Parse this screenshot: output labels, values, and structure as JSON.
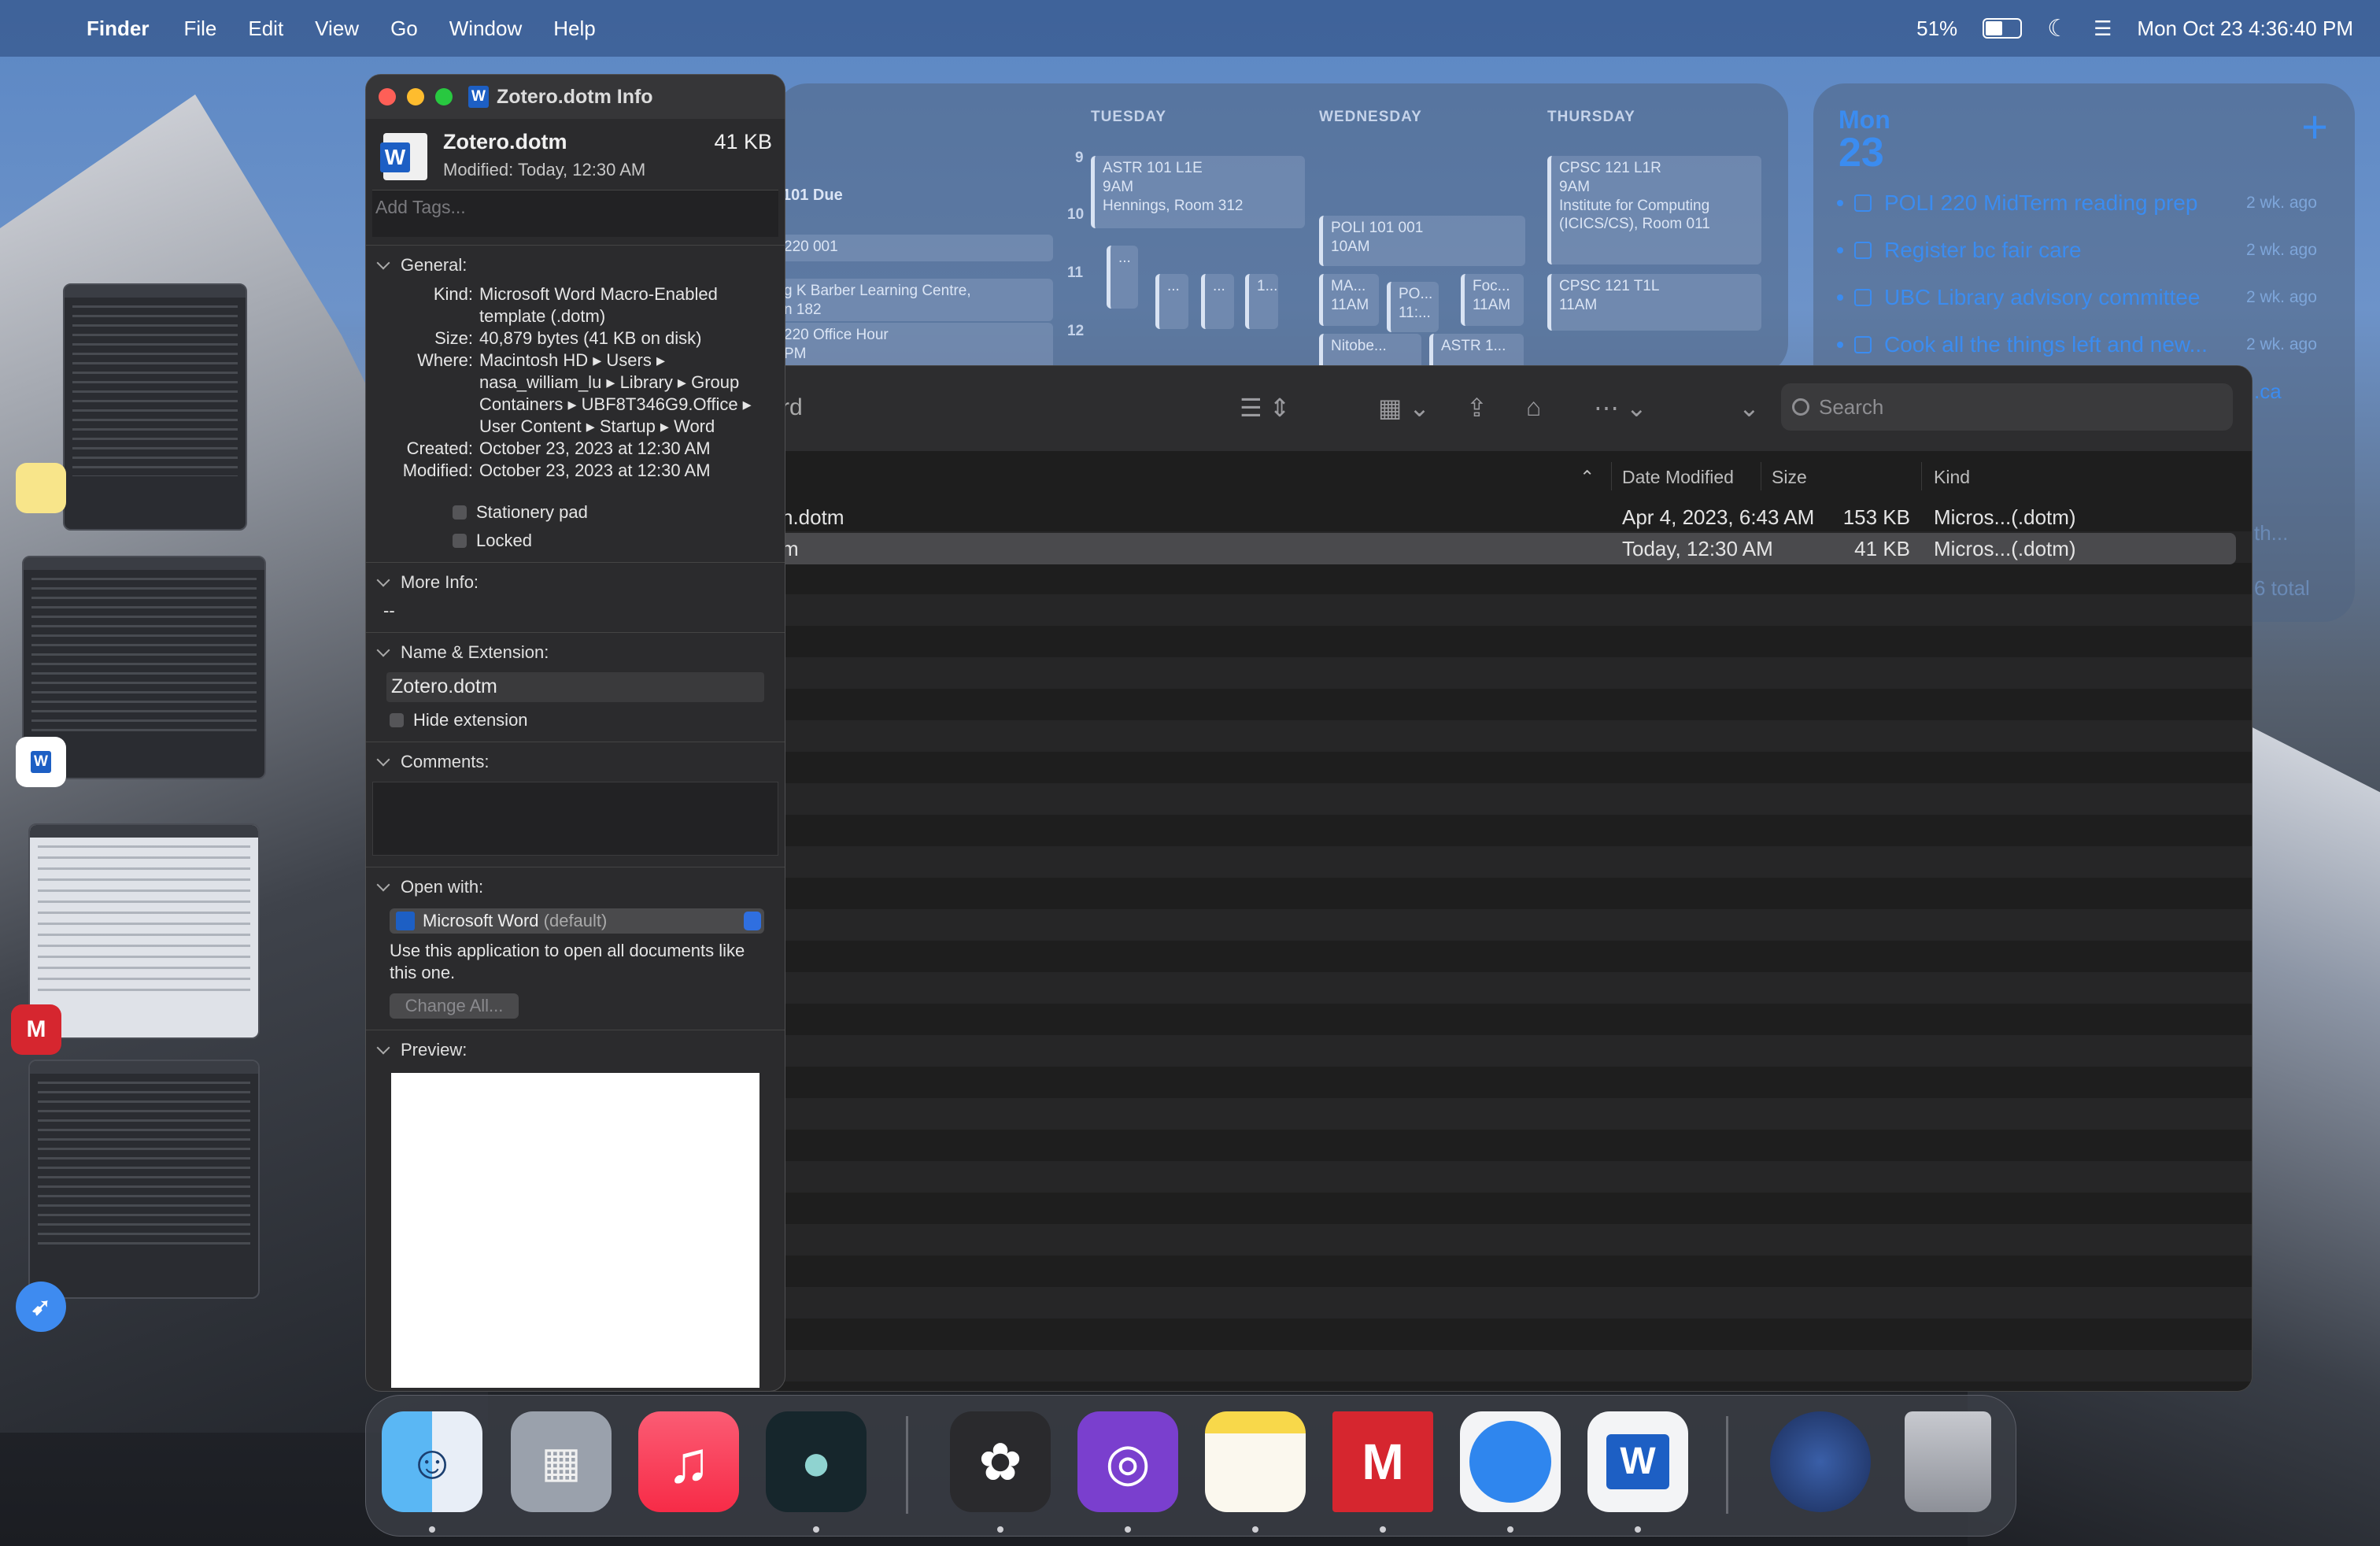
{
  "menubar": {
    "app_name": "Finder",
    "menus": [
      "File",
      "Edit",
      "View",
      "Go",
      "Window",
      "Help"
    ],
    "battery_percent": "51%",
    "battery_level": 0.51,
    "datetime": "Mon Oct 23  4:36:40 PM"
  },
  "calendar_widget": {
    "days": [
      "TUESDAY",
      "WEDNESDAY",
      "THURSDAY"
    ],
    "hours": [
      "9",
      "10",
      "11",
      "12"
    ],
    "left_events": [
      "101 Due",
      "220 001",
      "g K Barber Learning Centre,",
      "n 182",
      "220 Office Hour",
      "PM"
    ],
    "events": {
      "astr_title": "ASTR 101 L1E",
      "astr_time": "9AM",
      "astr_loc": "Hennings, Room 312",
      "poli_title": "POLI 101 001",
      "poli_time": "10AM",
      "ma_title": "MA...",
      "ma_time": "11AM",
      "po_title": "PO...",
      "po_time": "11:...",
      "foc_title": "Foc...",
      "foc_time": "11AM",
      "nitobe_title": "Nitobe...",
      "astr2_title": "ASTR 1...",
      "cpsc_title": "CPSC 121 L1R",
      "cpsc_time": "9AM",
      "cpsc_loc1": "Institute for Computing",
      "cpsc_loc2": "(ICICS/CS), Room 011",
      "cpsct_title": "CPSC 121 T1L",
      "cpsct_time": "11AM",
      "dots": "...",
      "one_dots": "1..."
    }
  },
  "reminders_widget": {
    "day_name": "Mon",
    "day_num": "23",
    "items": [
      {
        "title": "POLI 220 MidTerm reading prep",
        "ago": "2 wk. ago"
      },
      {
        "title": "Register bc fair care",
        "ago": "2 wk. ago"
      },
      {
        "title": "UBC Library advisory committee",
        "ago": "2 wk. ago"
      },
      {
        "title": "Cook all the things left and new...",
        "ago": "2 wk. ago"
      }
    ],
    "partial": [
      ".ca",
      "th...",
      "6 total"
    ]
  },
  "finder": {
    "title_fragment": "rd",
    "search_placeholder": "Search",
    "columns": {
      "date": "Date Modified",
      "size": "Size",
      "kind": "Kind"
    },
    "rows": [
      {
        "name": "n.dotm",
        "date": "Apr 4, 2023, 6:43 AM",
        "size": "153 KB",
        "kind": "Micros...(.dotm)"
      },
      {
        "name": "m",
        "date": "Today, 12:30 AM",
        "size": "41 KB",
        "kind": "Micros...(.dotm)"
      }
    ]
  },
  "info": {
    "window_title": "Zotero.dotm Info",
    "file_name": "Zotero.dotm",
    "file_size": "41 KB",
    "modified_short": "Modified:  Today, 12:30 AM",
    "tags_placeholder": "Add Tags...",
    "general_label": "General:",
    "kind_label": "Kind:",
    "kind_value": "Microsoft Word Macro-Enabled template (.dotm)",
    "size_label": "Size:",
    "size_value": "40,879 bytes (41 KB on disk)",
    "where_label": "Where:",
    "where_value": "Macintosh HD ▸ Users ▸ nasa_william_lu ▸ Library ▸ Group Containers ▸ UBF8T346G9.Office ▸ User Content ▸ Startup ▸ Word",
    "created_label": "Created:",
    "created_value": "October 23, 2023 at 12:30 AM",
    "modified_label": "Modified:",
    "modified_value": "October 23, 2023 at 12:30 AM",
    "stationery_label": "Stationery pad",
    "locked_label": "Locked",
    "more_info_label": "More Info:",
    "more_info_value": "--",
    "name_ext_label": "Name & Extension:",
    "name_field_value": "Zotero.dotm",
    "hide_ext_label": "Hide extension",
    "comments_label": "Comments:",
    "open_with_label": "Open with:",
    "open_with_app": "Microsoft Word",
    "open_with_default": "(default)",
    "open_with_desc": "Use this application to open all documents like this one.",
    "change_all_label": "Change All...",
    "preview_label": "Preview:"
  },
  "dock": {
    "apps": [
      "finder-icon",
      "launchpad-icon",
      "music-icon",
      "tableplus-icon",
      "chatgpt-icon",
      "github-desktop-icon",
      "notes-icon",
      "mendeley-icon",
      "safari-icon",
      "word-icon",
      "downloads-stack-icon",
      "trash-icon"
    ]
  },
  "colors": {
    "accent_blue": "#3b8cf0",
    "word_blue": "#1d5fc4",
    "traffic_red": "#fe5f57",
    "traffic_yellow": "#febc2e",
    "traffic_green": "#28c840"
  }
}
